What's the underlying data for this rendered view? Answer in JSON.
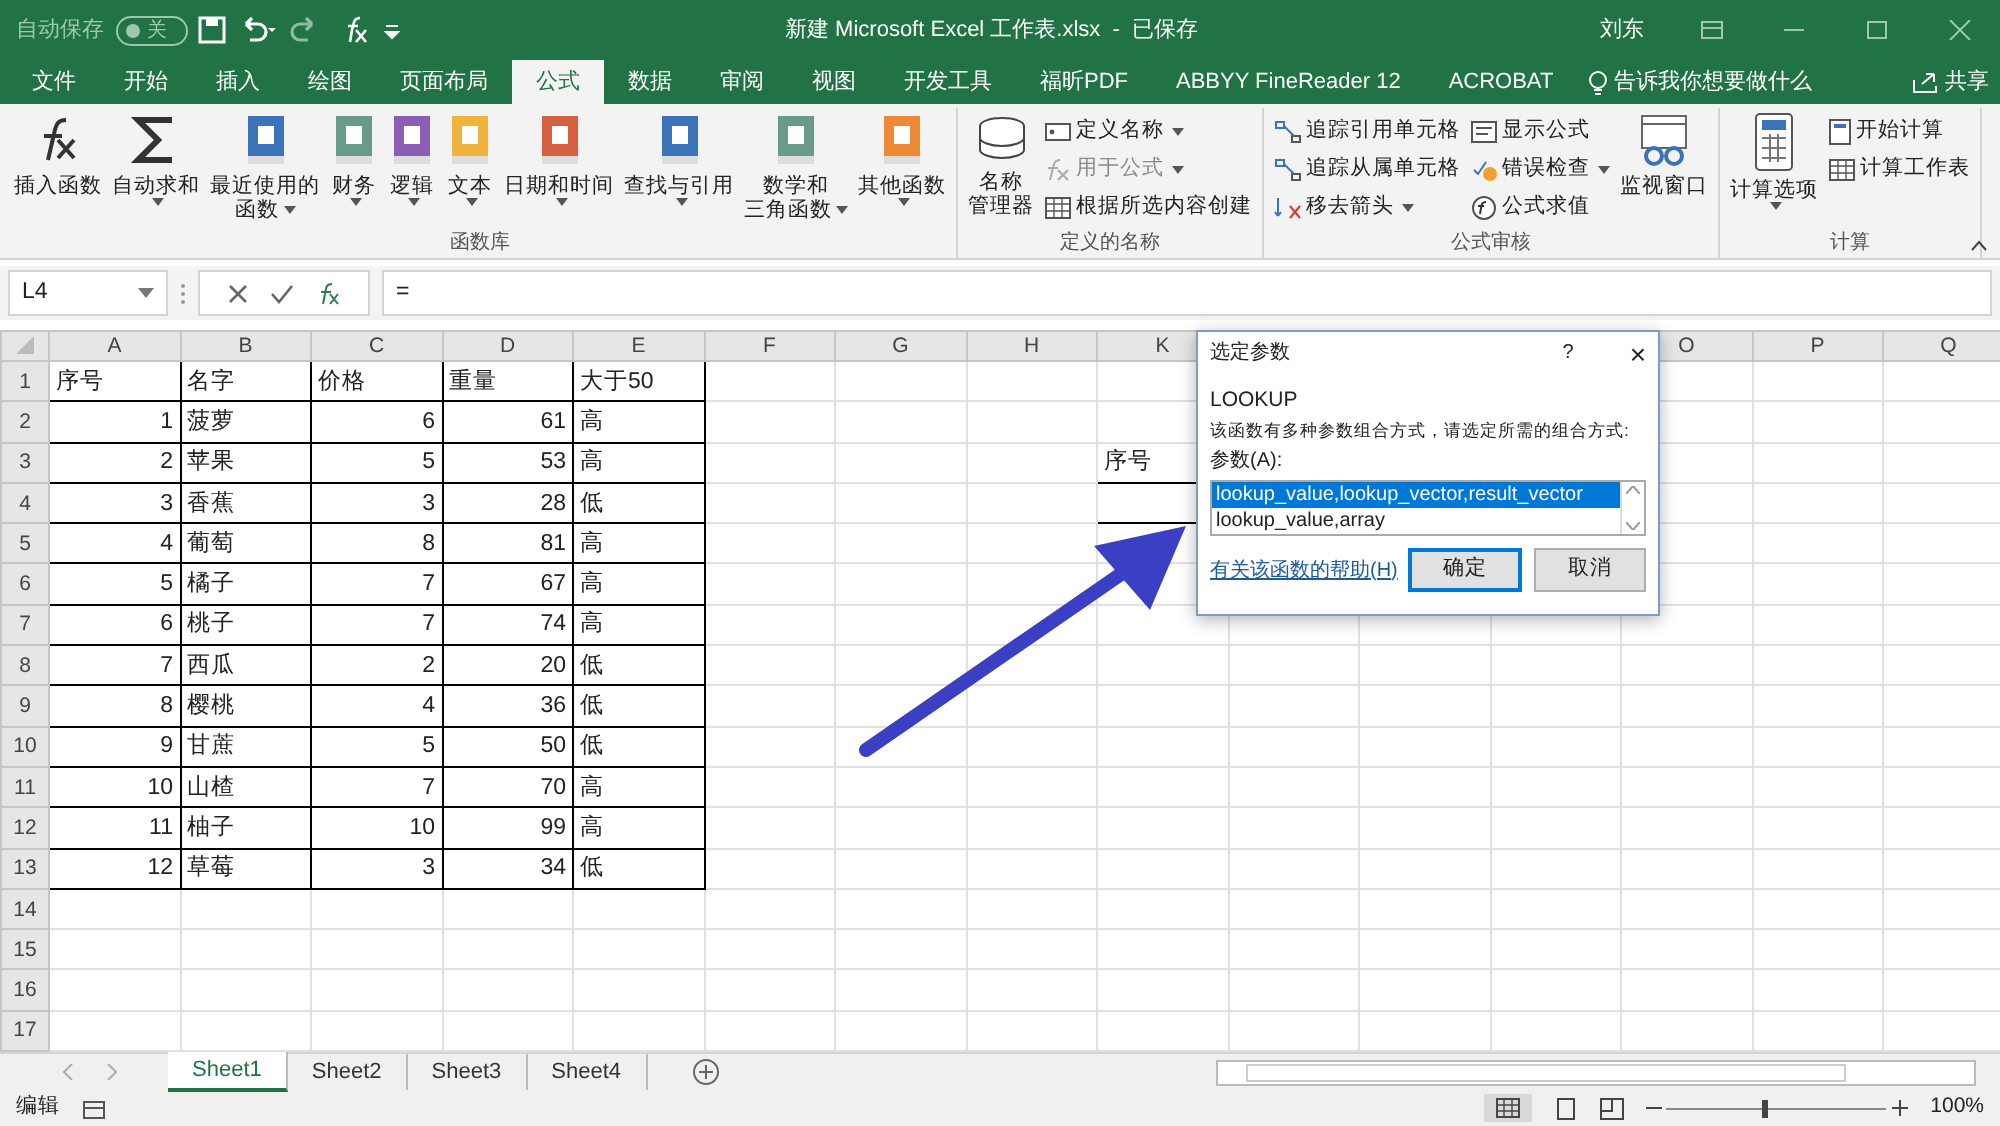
{
  "title_bar": {
    "autosave_label": "自动保存",
    "autosave_toggle": {
      "on": false,
      "label": "关"
    },
    "title": "新建 Microsoft Excel 工作表.xlsx  -  已保存",
    "user": "刘东"
  },
  "tabs": [
    {
      "label": "文件",
      "selected": false
    },
    {
      "label": "开始",
      "selected": false
    },
    {
      "label": "插入",
      "selected": false
    },
    {
      "label": "绘图",
      "selected": false
    },
    {
      "label": "页面布局",
      "selected": false
    },
    {
      "label": "公式",
      "selected": true
    },
    {
      "label": "数据",
      "selected": false
    },
    {
      "label": "审阅",
      "selected": false
    },
    {
      "label": "视图",
      "selected": false
    },
    {
      "label": "开发工具",
      "selected": false
    },
    {
      "label": "福昕PDF",
      "selected": false
    },
    {
      "label": "ABBYY FineReader 12",
      "selected": false
    },
    {
      "label": "ACROBAT",
      "selected": false
    }
  ],
  "tell_me": "告诉我你想要做什么",
  "share": "共享",
  "ribbon_groups": [
    {
      "title": "函数库",
      "items": [
        {
          "kind": "large",
          "lines": [
            "插入函数"
          ],
          "dropdown": false,
          "disabled": false
        },
        {
          "kind": "large",
          "lines": [
            "自动求和"
          ],
          "dropdown": true,
          "disabled": false
        },
        {
          "kind": "large",
          "lines": [
            "最近使用的",
            "函数"
          ],
          "dropdown": true,
          "disabled": false
        },
        {
          "kind": "large",
          "lines": [
            "财务"
          ],
          "dropdown": true,
          "disabled": false
        },
        {
          "kind": "large",
          "lines": [
            "逻辑"
          ],
          "dropdown": true,
          "disabled": false
        },
        {
          "kind": "large",
          "lines": [
            "文本"
          ],
          "dropdown": true,
          "disabled": false
        },
        {
          "kind": "large",
          "lines": [
            "日期和时间"
          ],
          "dropdown": true,
          "disabled": false
        },
        {
          "kind": "large",
          "lines": [
            "查找与引用"
          ],
          "dropdown": true,
          "disabled": false
        },
        {
          "kind": "large",
          "lines": [
            "数学和",
            "三角函数"
          ],
          "dropdown": true,
          "disabled": false
        },
        {
          "kind": "large",
          "lines": [
            "其他函数"
          ],
          "dropdown": true,
          "disabled": false
        }
      ]
    },
    {
      "title": "定义的名称",
      "items": [
        {
          "kind": "large",
          "lines": [
            "名称",
            "管理器"
          ],
          "dropdown": false,
          "disabled": false
        },
        {
          "kind": "small",
          "lines": [
            "定义名称"
          ],
          "dropdown": true,
          "disabled": false
        },
        {
          "kind": "small",
          "lines": [
            "用于公式"
          ],
          "dropdown": true,
          "disabled": true
        },
        {
          "kind": "small",
          "lines": [
            "根据所选内容创建"
          ],
          "dropdown": false,
          "disabled": false
        }
      ]
    },
    {
      "title": "公式审核",
      "items": [
        {
          "kind": "small",
          "lines": [
            "追踪引用单元格"
          ],
          "dropdown": false,
          "disabled": false
        },
        {
          "kind": "small",
          "lines": [
            "追踪从属单元格"
          ],
          "dropdown": false,
          "disabled": false
        },
        {
          "kind": "small",
          "lines": [
            "移去箭头"
          ],
          "dropdown": true,
          "disabled": false
        },
        {
          "kind": "small",
          "lines": [
            "显示公式"
          ],
          "dropdown": false,
          "disabled": false
        },
        {
          "kind": "small",
          "lines": [
            "错误检查"
          ],
          "dropdown": true,
          "disabled": false
        },
        {
          "kind": "small",
          "lines": [
            "公式求值"
          ],
          "dropdown": false,
          "disabled": false
        },
        {
          "kind": "large",
          "lines": [
            "监视窗口"
          ],
          "dropdown": false,
          "disabled": false
        }
      ]
    },
    {
      "title": "计算",
      "items": [
        {
          "kind": "large",
          "lines": [
            "计算选项"
          ],
          "dropdown": true,
          "disabled": false
        },
        {
          "kind": "small",
          "lines": [
            "开始计算"
          ],
          "dropdown": false,
          "disabled": false
        },
        {
          "kind": "small",
          "lines": [
            "计算工作表"
          ],
          "dropdown": false,
          "disabled": false
        }
      ]
    }
  ],
  "formula_bar": {
    "name_box": "L4",
    "formula": "="
  },
  "sheet": {
    "columns": [
      "A",
      "B",
      "C",
      "D",
      "E",
      "F",
      "G",
      "H",
      "K",
      "O",
      "P",
      "Q"
    ],
    "rows": [
      {
        "header": "1",
        "cells": [
          "序号",
          "名字",
          "价格",
          "重量",
          "大于50"
        ]
      },
      {
        "header": "2",
        "cells": [
          "1",
          "菠萝",
          "6",
          "61",
          "高"
        ]
      },
      {
        "header": "3",
        "cells": [
          "2",
          "苹果",
          "5",
          "53",
          "高"
        ],
        "k_cell": "序号"
      },
      {
        "header": "4",
        "cells": [
          "3",
          "香蕉",
          "3",
          "28",
          "低"
        ]
      },
      {
        "header": "5",
        "cells": [
          "4",
          "葡萄",
          "8",
          "81",
          "高"
        ]
      },
      {
        "header": "6",
        "cells": [
          "5",
          "橘子",
          "7",
          "67",
          "高"
        ]
      },
      {
        "header": "7",
        "cells": [
          "6",
          "桃子",
          "7",
          "74",
          "高"
        ]
      },
      {
        "header": "8",
        "cells": [
          "7",
          "西瓜",
          "2",
          "20",
          "低"
        ]
      },
      {
        "header": "9",
        "cells": [
          "8",
          "樱桃",
          "4",
          "36",
          "低"
        ]
      },
      {
        "header": "10",
        "cells": [
          "9",
          "甘蔗",
          "5",
          "50",
          "低"
        ]
      },
      {
        "header": "11",
        "cells": [
          "10",
          "山楂",
          "7",
          "70",
          "高"
        ]
      },
      {
        "header": "12",
        "cells": [
          "11",
          "柚子",
          "10",
          "99",
          "高"
        ]
      },
      {
        "header": "13",
        "cells": [
          "12",
          "草莓",
          "3",
          "34",
          "低"
        ]
      },
      {
        "header": "14",
        "cells": []
      },
      {
        "header": "15",
        "cells": []
      },
      {
        "header": "16",
        "cells": []
      },
      {
        "header": "17",
        "cells": []
      }
    ]
  },
  "dialog": {
    "title": "选定参数",
    "help": "?",
    "close": "×",
    "function": "LOOKUP",
    "description": "该函数有多种参数组合方式，请选定所需的组合方式:",
    "label": "参数(A):",
    "options": [
      {
        "text": "lookup_value,lookup_vector,result_vector",
        "selected": true
      },
      {
        "text": "lookup_value,array",
        "selected": false
      }
    ],
    "help_link": "有关该函数的帮助(H)",
    "buttons": [
      "确定",
      "取消"
    ]
  },
  "sheet_tabs": [
    {
      "label": "Sheet1",
      "selected": true
    },
    {
      "label": "Sheet2",
      "selected": false
    },
    {
      "label": "Sheet3",
      "selected": false
    },
    {
      "label": "Sheet4",
      "selected": false
    }
  ],
  "status_bar": {
    "mode": "编辑",
    "zoom": "100%",
    "zoom_slider": {
      "level": 0.45
    }
  }
}
